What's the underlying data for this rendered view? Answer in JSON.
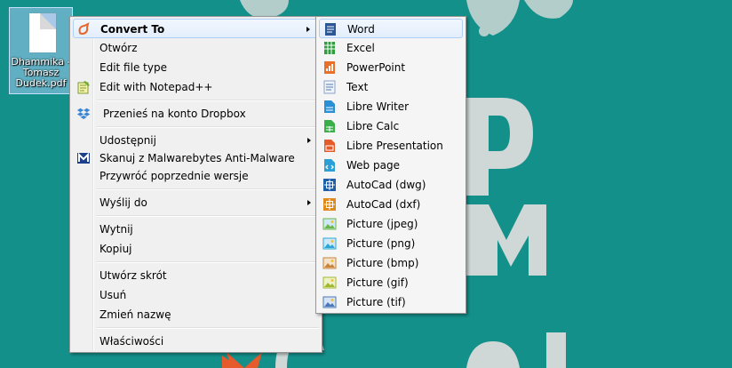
{
  "desktop": {
    "file_label": "Dhammika - Tomasz Dudek.pdf"
  },
  "context_menu": {
    "items": [
      {
        "label": "Convert To",
        "icon": "convert-logo-icon",
        "submenu": true,
        "bold": true
      },
      {
        "label": "Otwórz"
      },
      {
        "label": "Edit file type"
      },
      {
        "label": "Edit with Notepad++",
        "icon": "notepad-plus-icon"
      },
      {
        "label": "Przenieś na konto Dropbox",
        "icon": "dropbox-icon"
      },
      {
        "label": "Udostępnij",
        "submenu": true
      },
      {
        "label": "Skanuj z Malwarebytes Anti-Malware",
        "icon": "malwarebytes-icon"
      },
      {
        "label": "Przywróć poprzednie wersje"
      },
      {
        "label": "Wyślij do",
        "submenu": true
      },
      {
        "label": "Wytnij"
      },
      {
        "label": "Kopiuj"
      },
      {
        "label": "Utwórz skrót"
      },
      {
        "label": "Usuń"
      },
      {
        "label": "Zmień nazwę"
      },
      {
        "label": "Właściwości"
      }
    ]
  },
  "convert_submenu": {
    "items": [
      {
        "label": "Word",
        "icon": "word-doc-icon",
        "color": "#2b5797"
      },
      {
        "label": "Excel",
        "icon": "excel-grid-icon",
        "color": "#2e9e3e"
      },
      {
        "label": "PowerPoint",
        "icon": "powerpoint-icon",
        "color": "#e8702a"
      },
      {
        "label": "Text",
        "icon": "text-doc-icon",
        "color": "#8aa4c8"
      },
      {
        "label": "Libre Writer",
        "icon": "libre-writer-icon",
        "color": "#2b8fd6"
      },
      {
        "label": "Libre Calc",
        "icon": "libre-calc-icon",
        "color": "#3aae49"
      },
      {
        "label": "Libre Presentation",
        "icon": "libre-presentation-icon",
        "color": "#e45a2a"
      },
      {
        "label": "Web page",
        "icon": "web-page-icon",
        "color": "#2a9fd6"
      },
      {
        "label": "AutoCad (dwg)",
        "icon": "autocad-dwg-icon",
        "color": "#1d5fa8"
      },
      {
        "label": "AutoCad (dxf)",
        "icon": "autocad-dxf-icon",
        "color": "#e08a1e"
      },
      {
        "label": "Picture (jpeg)",
        "icon": "picture-jpeg-icon",
        "color": "#6bb84a"
      },
      {
        "label": "Picture (png)",
        "icon": "picture-png-icon",
        "color": "#2aa7d6"
      },
      {
        "label": "Picture (bmp)",
        "icon": "picture-bmp-icon",
        "color": "#c7843a"
      },
      {
        "label": "Picture (gif)",
        "icon": "picture-gif-icon",
        "color": "#a0b830"
      },
      {
        "label": "Picture (tif)",
        "icon": "picture-tif-icon",
        "color": "#4a78b8"
      }
    ]
  },
  "colors": {
    "desktop_bg": "#14908b",
    "menu_bg": "#f0f0f0",
    "highlight_border": "#aecff7"
  }
}
